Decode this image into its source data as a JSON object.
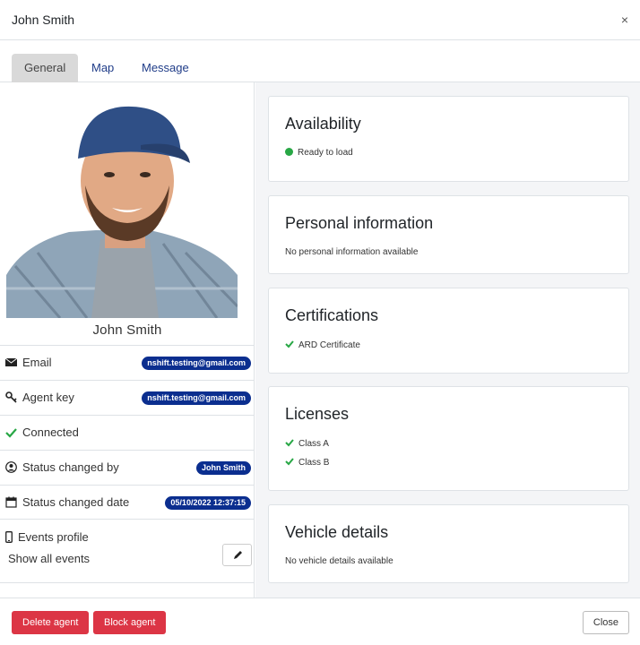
{
  "dialog": {
    "title": "John Smith",
    "close_symbol": "×"
  },
  "tabs": [
    {
      "label": "General",
      "active": true
    },
    {
      "label": "Map",
      "active": false
    },
    {
      "label": "Message",
      "active": false
    }
  ],
  "agent": {
    "name": "John Smith",
    "rows": {
      "email": {
        "label": "Email",
        "value": "nshift.testing@gmail.com",
        "icon": "envelope-icon"
      },
      "agent_key": {
        "label": "Agent key",
        "value": "nshift.testing@gmail.com",
        "icon": "key-icon"
      },
      "connected": {
        "label": "Connected",
        "icon": "check-icon"
      },
      "status_changed_by": {
        "label": "Status changed by",
        "value": "John Smith",
        "icon": "user-circle-icon"
      },
      "status_changed_date": {
        "label": "Status changed date",
        "value": "05/10/2022 12:37:15",
        "icon": "calendar-icon"
      }
    },
    "events": {
      "label": "Events profile",
      "link": "Show all events",
      "icon": "mobile-icon"
    }
  },
  "cards": {
    "availability": {
      "title": "Availability",
      "status": "Ready to load",
      "status_color": "#28a745"
    },
    "personal": {
      "title": "Personal information",
      "text": "No personal information available"
    },
    "certifications": {
      "title": "Certifications",
      "items": [
        "ARD Certificate"
      ]
    },
    "licenses": {
      "title": "Licenses",
      "items": [
        "Class A",
        "Class B"
      ]
    },
    "vehicle": {
      "title": "Vehicle details",
      "text": "No vehicle details available"
    }
  },
  "footer": {
    "delete_label": "Delete agent",
    "block_label": "Block agent",
    "close_label": "Close"
  },
  "colors": {
    "accent_blue": "#0b2e8f",
    "danger": "#dc3545",
    "success": "#28a745"
  }
}
